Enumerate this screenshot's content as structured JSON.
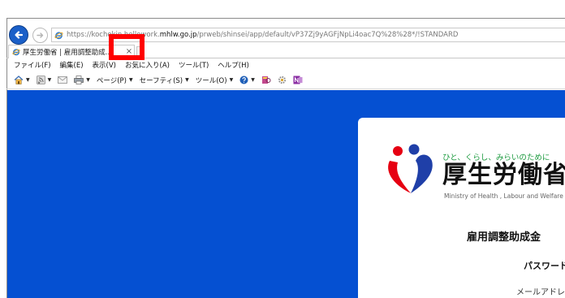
{
  "browser": {
    "address": {
      "url_prefix": "https://",
      "url_host_pre": "kochokin.hellowork.",
      "url_host_bold": "mhlw.go.jp",
      "url_path": "/prweb/shinsei/app/default/vP37Zj9yAGFjNpLi4oac7Q%28%28*/!STANDARD"
    },
    "tab": {
      "title": "厚生労働省 | 雇用調整助成...",
      "close_glyph": "×"
    },
    "menu": [
      "ファイル(F)",
      "編集(E)",
      "表示(V)",
      "お気に入り(A)",
      "ツール(T)",
      "ヘルプ(H)"
    ],
    "commands": {
      "page": "ページ(P)",
      "safety": "セーフティ(S)",
      "tools": "ツール(O)"
    }
  },
  "page": {
    "logo_tagline": "ひと、くらし、みらいのために",
    "logo_name": "厚生労働省",
    "logo_english": "Ministry of Health , Labour and Welfare",
    "heading": "雇用調整助成金",
    "subheading": "パスワード",
    "field_label": "メールアドレス"
  },
  "colors": {
    "content_background": "#0550d2",
    "highlight": "#ff0000",
    "back_button": "#1a5fc8",
    "logo_green": "#1b9a3e"
  }
}
